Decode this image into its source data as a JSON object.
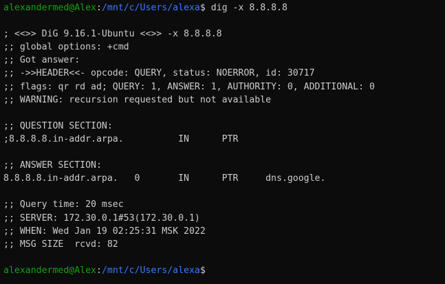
{
  "colors": {
    "background": "#0c0c0c",
    "text": "#cccccc",
    "user_host": "#13a10e",
    "path": "#3b78ff"
  },
  "prompt1": {
    "user_host": "alexandermed@Alex",
    "separator": ":",
    "path": "/mnt/c/Users/alexa",
    "symbol": "$",
    "command": " dig -x 8.8.8.8"
  },
  "output": {
    "lines": [
      "",
      "; <<>> DiG 9.16.1-Ubuntu <<>> -x 8.8.8.8",
      ";; global options: +cmd",
      ";; Got answer:",
      ";; ->>HEADER<<- opcode: QUERY, status: NOERROR, id: 30717",
      ";; flags: qr rd ad; QUERY: 1, ANSWER: 1, AUTHORITY: 0, ADDITIONAL: 0",
      ";; WARNING: recursion requested but not available",
      "",
      ";; QUESTION SECTION:",
      ";8.8.8.8.in-addr.arpa.          IN      PTR",
      "",
      ";; ANSWER SECTION:",
      "8.8.8.8.in-addr.arpa.   0       IN      PTR     dns.google.",
      "",
      ";; Query time: 20 msec",
      ";; SERVER: 172.30.0.1#53(172.30.0.1)",
      ";; WHEN: Wed Jan 19 02:25:31 MSK 2022",
      ";; MSG SIZE  rcvd: 82",
      ""
    ]
  },
  "prompt2": {
    "user_host": "alexandermed@Alex",
    "separator": ":",
    "path": "/mnt/c/Users/alexa",
    "symbol": "$",
    "command": ""
  }
}
